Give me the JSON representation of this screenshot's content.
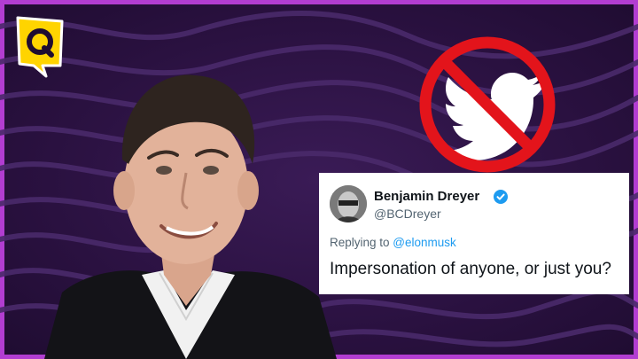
{
  "brand": {
    "logo_icon": "quint-q-logo-icon",
    "accent": "#b23dd1"
  },
  "banned_icon": "twitter-bird-prohibited-icon",
  "tweet": {
    "name": "Benjamin Dreyer",
    "handle": "@BCDreyer",
    "replying_prefix": "Replying to ",
    "replying_to": "@elonmusk",
    "text": "Impersonation of anyone, or just you?",
    "verified_color": "#1d9bf0"
  }
}
